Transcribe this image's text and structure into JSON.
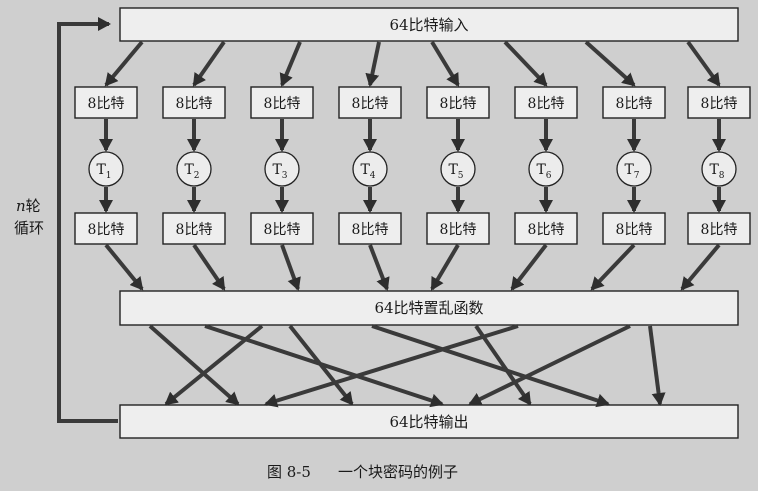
{
  "diagram": {
    "input_label": "64比特输入",
    "scramble_label": "64比特置乱函数",
    "output_label": "64比特输出",
    "byte_label": "8比特",
    "t_boxes": [
      {
        "letter": "T",
        "sub": "1"
      },
      {
        "letter": "T",
        "sub": "2"
      },
      {
        "letter": "T",
        "sub": "3"
      },
      {
        "letter": "T",
        "sub": "4"
      },
      {
        "letter": "T",
        "sub": "5"
      },
      {
        "letter": "T",
        "sub": "6"
      },
      {
        "letter": "T",
        "sub": "7"
      },
      {
        "letter": "T",
        "sub": "8"
      }
    ],
    "loop_label_var": "n",
    "loop_label_line1": "轮",
    "loop_label_line2": "循环"
  },
  "caption": {
    "figure_number": "图 8-5",
    "title": "一个块密码的例子"
  }
}
